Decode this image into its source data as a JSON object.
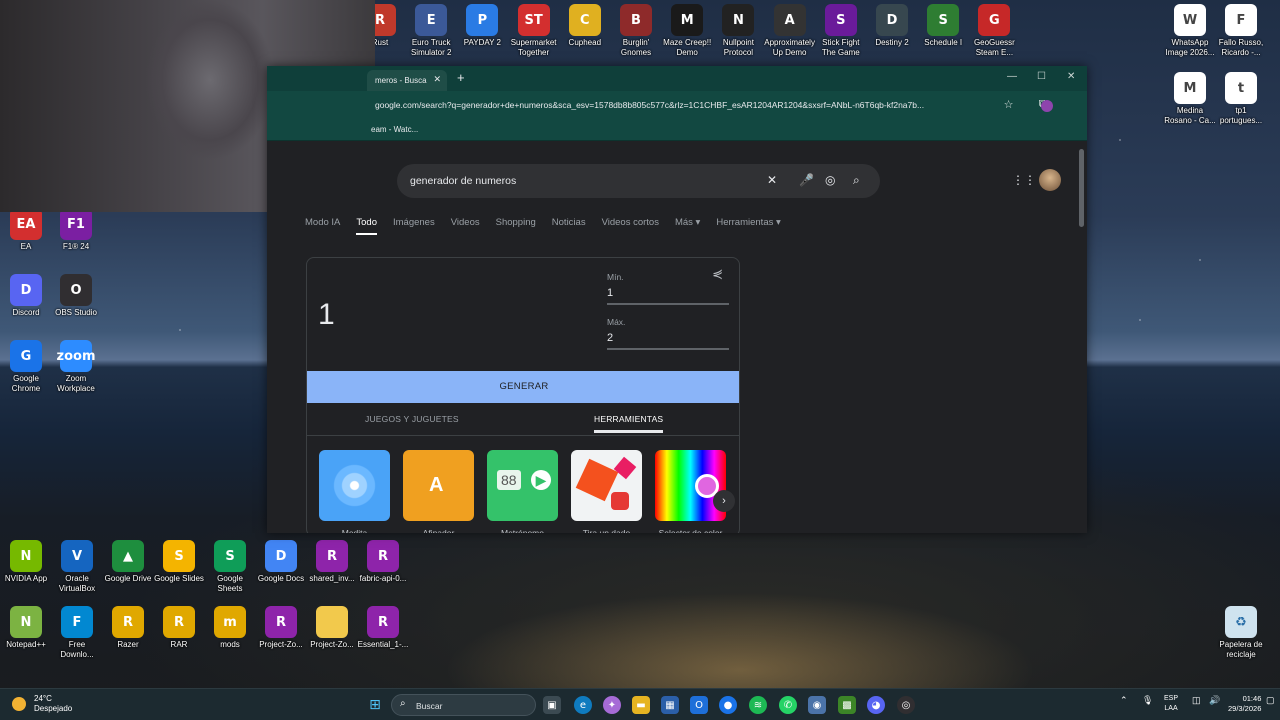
{
  "desktop": {
    "top_icons": [
      {
        "label": "Rust",
        "color": "#c0392b",
        "glyph": "R"
      },
      {
        "label": "Euro Truck Simulator 2",
        "color": "#3b5998",
        "glyph": "E"
      },
      {
        "label": "PAYDAY 2",
        "color": "#2a7be4",
        "glyph": "P"
      },
      {
        "label": "Supermarket Together",
        "color": "#d32f2f",
        "glyph": "ST"
      },
      {
        "label": "Cuphead",
        "color": "#e0b020",
        "glyph": "C"
      },
      {
        "label": "Burglin' Gnomes",
        "color": "#8e2a2a",
        "glyph": "B"
      },
      {
        "label": "Maze Creep!! Demo",
        "color": "#1a1a1a",
        "glyph": "M"
      },
      {
        "label": "Nullpoint Protocol",
        "color": "#222222",
        "glyph": "N"
      },
      {
        "label": "Approximately Up Demo",
        "color": "#333333",
        "glyph": "A"
      },
      {
        "label": "Stick Fight The Game",
        "color": "#6a1b9a",
        "glyph": "S"
      },
      {
        "label": "Destiny 2",
        "color": "#37474f",
        "glyph": "D"
      },
      {
        "label": "Schedule I",
        "color": "#2e7d32",
        "glyph": "S"
      },
      {
        "label": "GeoGuessr Steam E...",
        "color": "#c62828",
        "glyph": "G"
      }
    ],
    "right_icons": [
      {
        "label": "WhatsApp Image 2026...",
        "color": "#ffffff",
        "glyph": "W"
      },
      {
        "label": "Fallo Russo, Ricardo -...",
        "color": "#ffffff",
        "glyph": "F"
      },
      {
        "label": "Medina Rosano - Ca...",
        "color": "#ffffff",
        "glyph": "M"
      },
      {
        "label": "tp1 portugues...",
        "color": "#ffffff",
        "glyph": "t"
      }
    ],
    "left_icons": [
      {
        "label": "EA",
        "color": "#d32f2f",
        "glyph": "EA"
      },
      {
        "label": "F1® 24",
        "color": "#7b1fa2",
        "glyph": "F1"
      },
      {
        "label": "Discord",
        "color": "#5865f2",
        "glyph": "D"
      },
      {
        "label": "OBS Studio",
        "color": "#302e31",
        "glyph": "O"
      },
      {
        "label": "Google Chrome",
        "color": "#1a73e8",
        "glyph": "G"
      },
      {
        "label": "Zoom Workplace",
        "color": "#2d8cff",
        "glyph": "zoom"
      }
    ],
    "bottom_row1": [
      {
        "label": "NVIDIA App",
        "color": "#76b900",
        "glyph": "N"
      },
      {
        "label": "Oracle VirtualBox",
        "color": "#1565c0",
        "glyph": "V"
      },
      {
        "label": "Google Drive",
        "color": "#1e8e3e",
        "glyph": "▲"
      },
      {
        "label": "Google Slides",
        "color": "#f4b400",
        "glyph": "S"
      },
      {
        "label": "Google Sheets",
        "color": "#0f9d58",
        "glyph": "S"
      },
      {
        "label": "Google Docs",
        "color": "#4285f4",
        "glyph": "D"
      },
      {
        "label": "shared_inv...",
        "color": "#8e24aa",
        "glyph": "R"
      },
      {
        "label": "fabric-api-0...",
        "color": "#8e24aa",
        "glyph": "R"
      }
    ],
    "bottom_row2": [
      {
        "label": "Notepad++",
        "color": "#7cb342",
        "glyph": "N"
      },
      {
        "label": "Free Downlo...",
        "color": "#0288d1",
        "glyph": "F"
      },
      {
        "label": "Razer",
        "color": "#e0a800",
        "glyph": "R"
      },
      {
        "label": "RAR",
        "color": "#e0a800",
        "glyph": "R"
      },
      {
        "label": "mods",
        "color": "#e0a800",
        "glyph": "m"
      },
      {
        "label": "Project-Zo...",
        "color": "#8e24aa",
        "glyph": "R"
      },
      {
        "label": "Project-Zo...",
        "color": "#f2c94c",
        "glyph": ""
      },
      {
        "label": "Essential_1-...",
        "color": "#8e24aa",
        "glyph": "R"
      }
    ],
    "recycle_bin": "Papelera de reciclaje"
  },
  "browser": {
    "tab_title": "meros - Busca",
    "url": "google.com/search?q=generador+de+numeros&sca_esv=1578db8b805c577c&rlz=1C1CHBF_esAR1204AR1204&sxsrf=ANbL-n6T6qb-kf2na7b...",
    "bookmark": "eam - Watc...",
    "search_query": "generador de numeros",
    "filters": [
      "Modo IA",
      "Todo",
      "Imágenes",
      "Videos",
      "Shopping",
      "Noticias",
      "Videos cortos",
      "Más ▾",
      "Herramientas ▾"
    ],
    "active_filter_index": 1,
    "rng": {
      "result": "1",
      "min_label": "Mín.",
      "min_value": "1",
      "max_label": "Máx.",
      "max_value": "2",
      "generate_label": "GENERAR",
      "tab_games": "JUEGOS Y JUGUETES",
      "tab_tools": "HERRAMIENTAS",
      "tools": [
        {
          "label": "Medita"
        },
        {
          "label": "Afinador"
        },
        {
          "label": "Metrónomo"
        },
        {
          "label": "Tira un dado"
        },
        {
          "label": "Selector de color"
        }
      ],
      "metronome_bpm": "88"
    }
  },
  "taskbar": {
    "weather_temp": "24°C",
    "weather_desc": "Despejado",
    "search_placeholder": "Buscar",
    "lang_top": "ESP",
    "lang_bottom": "LAA",
    "time": "01:46",
    "date": "29/3/2026"
  }
}
